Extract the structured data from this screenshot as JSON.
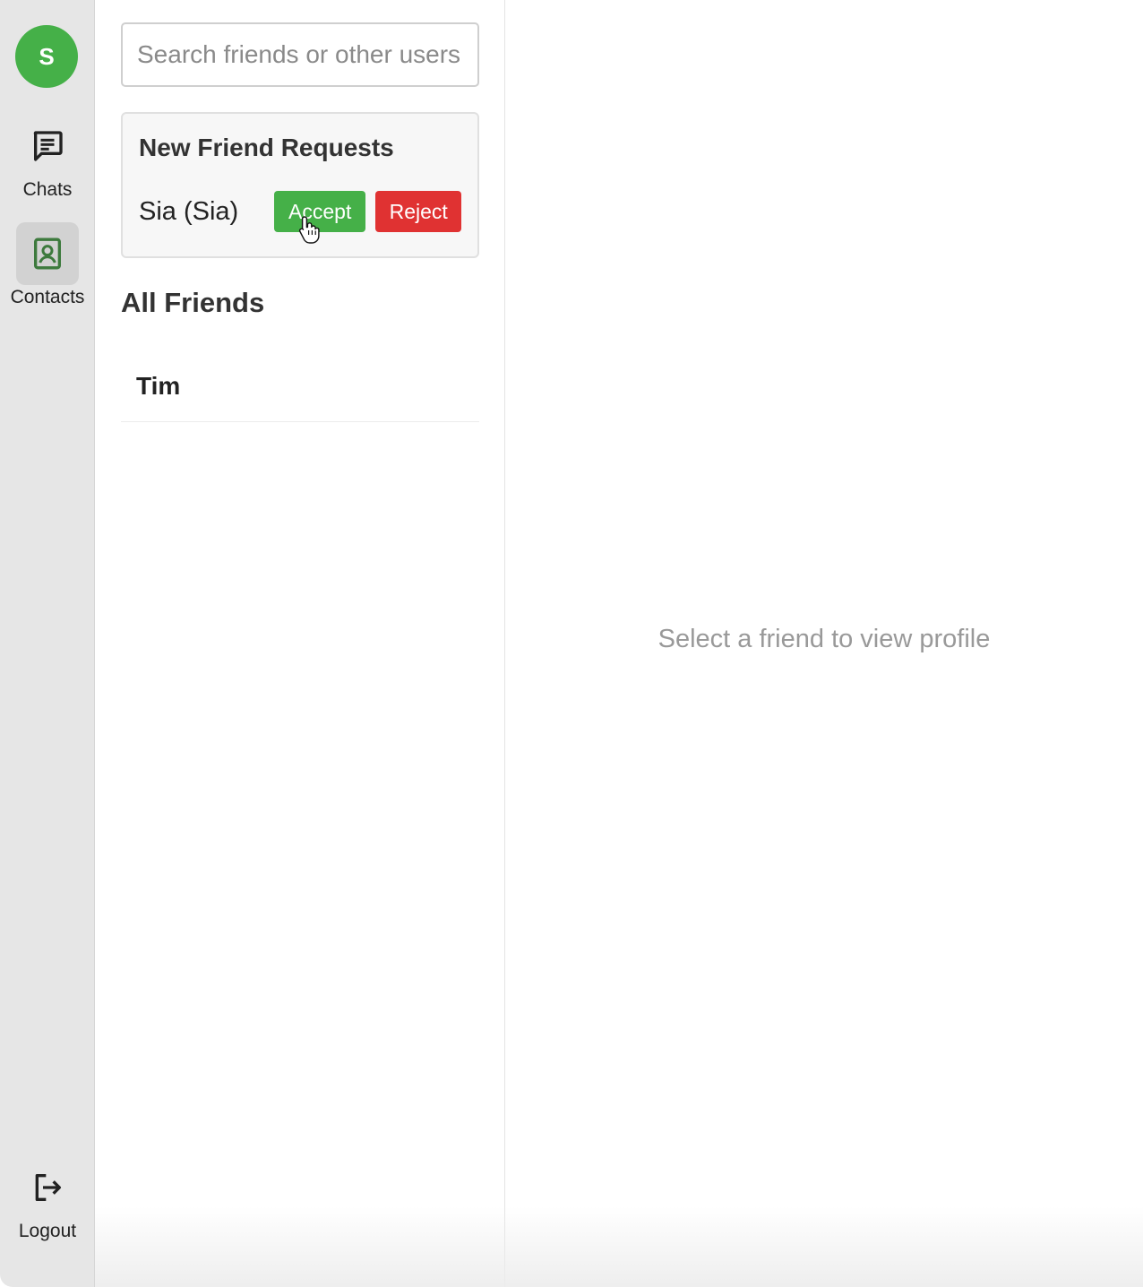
{
  "user": {
    "avatar_initial": "S",
    "avatar_color": "#45b048"
  },
  "nav": {
    "chats_label": "Chats",
    "contacts_label": "Contacts",
    "logout_label": "Logout",
    "active": "contacts"
  },
  "search": {
    "placeholder": "Search friends or other users",
    "value": ""
  },
  "friend_requests": {
    "title": "New Friend Requests",
    "items": [
      {
        "name": "Sia (Sia)",
        "accept_label": "Accept",
        "reject_label": "Reject"
      }
    ]
  },
  "friends": {
    "title": "All Friends",
    "items": [
      {
        "name": "Tim"
      }
    ]
  },
  "profile": {
    "placeholder": "Select a friend to view profile"
  },
  "colors": {
    "accent_green": "#45b048",
    "danger_red": "#e03232",
    "rail_bg": "#e6e6e6"
  },
  "icons": {
    "chats": "chat-bubble-icon",
    "contacts": "contact-card-icon",
    "logout": "logout-icon"
  }
}
